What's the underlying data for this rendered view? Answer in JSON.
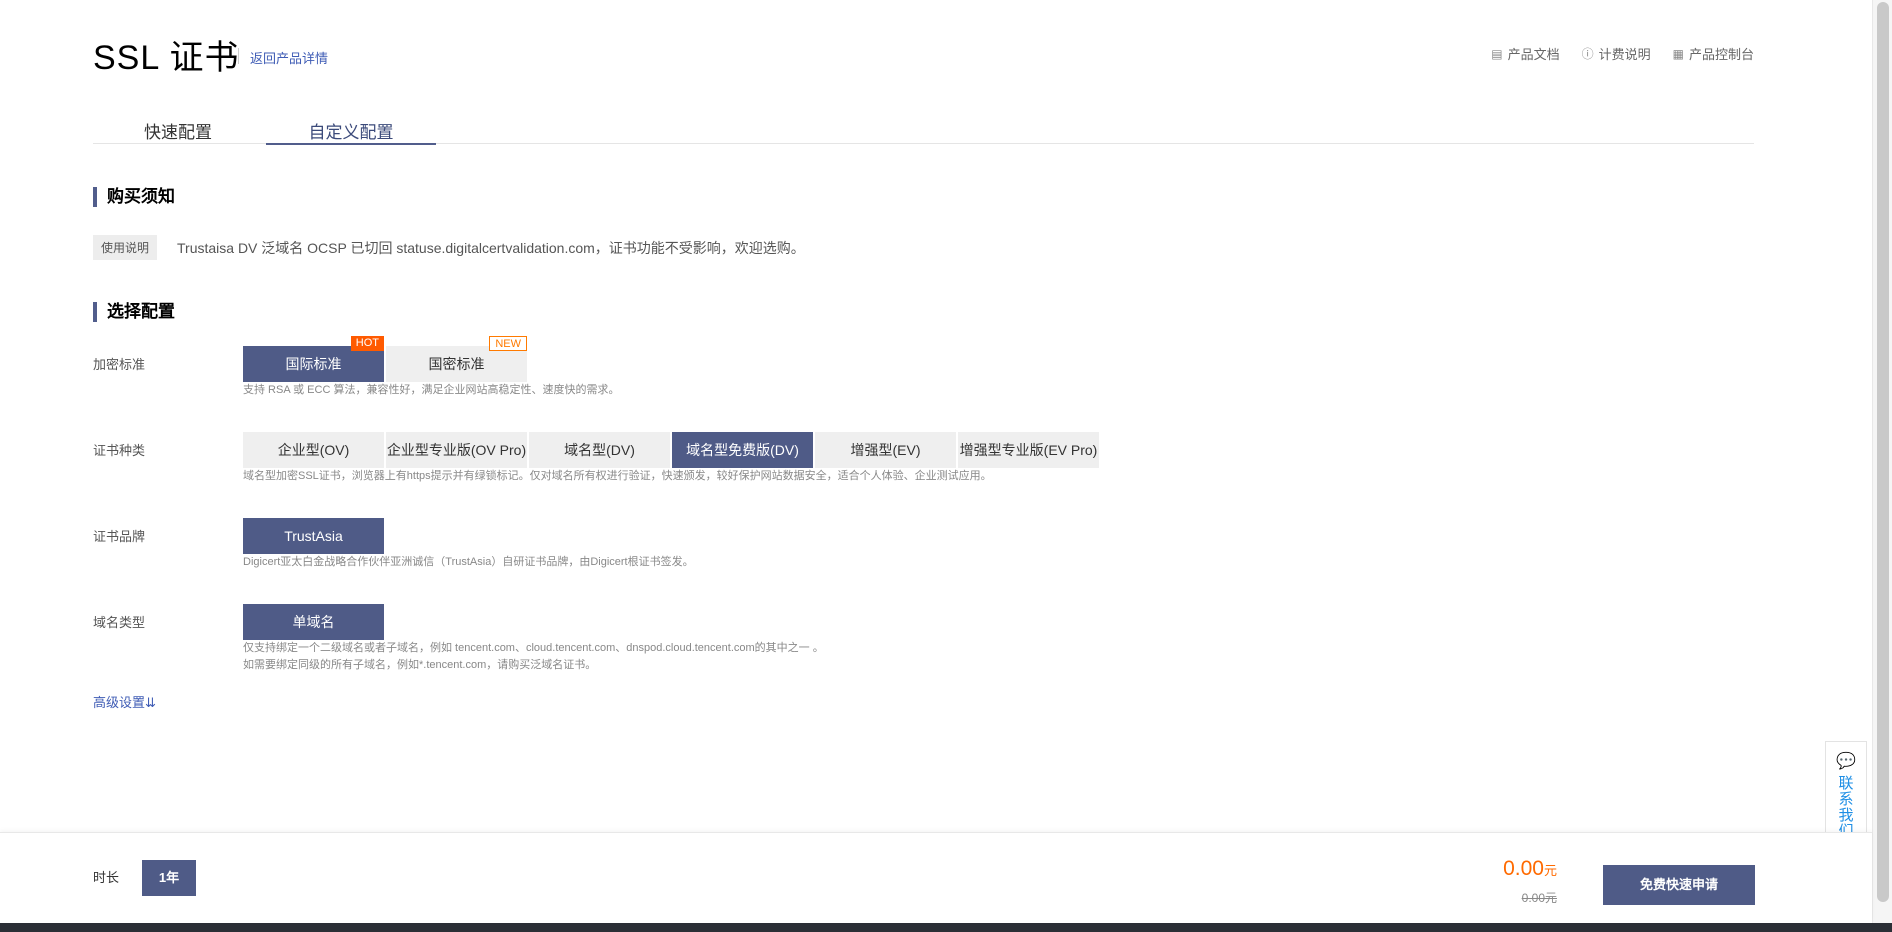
{
  "header": {
    "title": "SSL 证书",
    "back_link": "返回产品详情",
    "links": [
      {
        "icon": "document-icon",
        "label": "产品文档"
      },
      {
        "icon": "info-icon",
        "label": "计费说明"
      },
      {
        "icon": "grid-icon",
        "label": "产品控制台"
      }
    ]
  },
  "tabs": [
    {
      "label": "快速配置",
      "selected": false
    },
    {
      "label": "自定义配置",
      "selected": true
    }
  ],
  "notice": {
    "title": "购买须知",
    "tag": "使用说明",
    "text": "Trustaisa DV 泛域名 OCSP 已切回 statuse.digitalcertvalidation.com，证书功能不受影响，欢迎选购。"
  },
  "config": {
    "title": "选择配置",
    "encryption": {
      "label": "加密标准",
      "options": [
        {
          "label": "国际标准",
          "selected": true,
          "badge": "HOT"
        },
        {
          "label": "国密标准",
          "selected": false,
          "badge": "NEW"
        }
      ],
      "hint": "支持 RSA 或 ECC 算法，兼容性好，满足企业网站高稳定性、速度快的需求。"
    },
    "cert_type": {
      "label": "证书种类",
      "options": [
        {
          "label": "企业型(OV)",
          "selected": false
        },
        {
          "label": "企业型专业版(OV Pro)",
          "selected": false
        },
        {
          "label": "域名型(DV)",
          "selected": false
        },
        {
          "label": "域名型免费版(DV)",
          "selected": true
        },
        {
          "label": "增强型(EV)",
          "selected": false
        },
        {
          "label": "增强型专业版(EV Pro)",
          "selected": false
        }
      ],
      "hint": "域名型加密SSL证书，浏览器上有https提示并有绿锁标记。仅对域名所有权进行验证，快速颁发，较好保护网站数据安全，适合个人体验、企业测试应用。"
    },
    "brand": {
      "label": "证书品牌",
      "options": [
        {
          "label": "TrustAsia",
          "selected": true
        }
      ],
      "hint": "Digicert亚太白金战略合作伙伴亚洲诚信（TrustAsia）自研证书品牌，由Digicert根证书签发。"
    },
    "domain_type": {
      "label": "域名类型",
      "options": [
        {
          "label": "单域名",
          "selected": true
        }
      ],
      "hint_line1": "仅支持绑定一个二级域名或者子域名，例如 tencent.com、cloud.tencent.com、dnspod.cloud.tencent.com的其中之一 。",
      "hint_line2": "如需要绑定同级的所有子域名，例如*.tencent.com，请购买泛域名证书。"
    },
    "advanced": "高级设置"
  },
  "contact": {
    "icon": "chat-icon",
    "label": "联系我们"
  },
  "footer": {
    "duration_label": "时长",
    "duration_value": "1年",
    "price": "0.00",
    "price_unit": "元",
    "original_price": "0.00元",
    "apply_button": "免费快速申请"
  },
  "colors": {
    "accent": "#4f5b87",
    "link": "#3f5cb5",
    "hot_badge": "#ff5a00",
    "price": "#ff6a00"
  }
}
